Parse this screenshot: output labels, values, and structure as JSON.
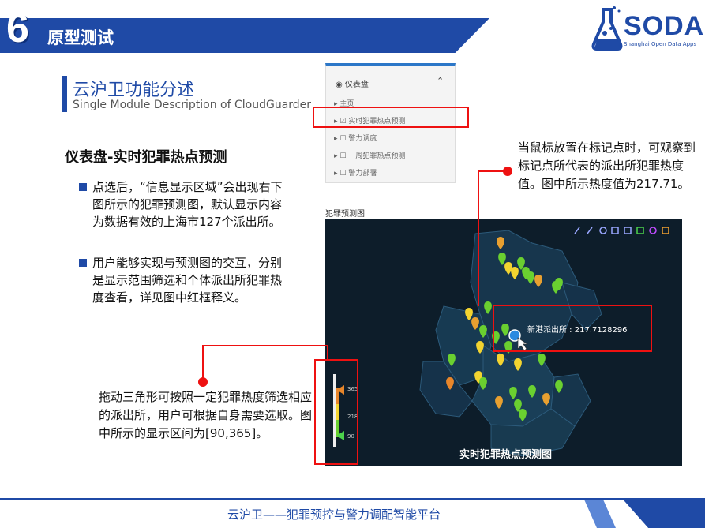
{
  "header": {
    "number": "6",
    "title": "原型测试",
    "logo": {
      "name": "SODA",
      "subtitle": "Shanghai Open Data Apps"
    }
  },
  "section": {
    "title": "云沪卫功能分述",
    "subtitle": "Single Module Description of CloudGuarder"
  },
  "dashboard_title": "仪表盘-实时犯罪热点预测",
  "bullets": [
    "点选后，“信息显示区域”会出现右下图所示的犯罪预测图，默认显示内容为数据有效的上海市127个派出所。",
    "用户能够实现与预测图的交互，分别是显示范围筛选和个体派出所犯罪热度查看，详见图中红框释义。"
  ],
  "menu": {
    "header": "仪表盘",
    "items": [
      "主页",
      "实时犯罪热点预测",
      "警力调度",
      "一周犯罪热点预测",
      "警力部署"
    ]
  },
  "map": {
    "label": "犯罪预测图",
    "caption": "实时犯罪热点预测图",
    "tooltip": "新港派出所 : 217.7128296",
    "slider_values": [
      "365",
      "218",
      "90"
    ]
  },
  "annotations": {
    "right": "当鼠标放置在标记点时，可观察到标记点所代表的派出所犯罪热度值。图中所示热度值为217.71。",
    "left": "拖动三角形可按照一定犯罪热度筛选相应的派出所，用户可根据自身需要选取。图中所示的显示区间为[90,365]。"
  },
  "footer": "云沪卫——犯罪预控与警力调配智能平台",
  "colors": {
    "brand_blue": "#1f4aa6",
    "highlight_red": "#ee1111",
    "map_bg": "#0d1d2a"
  }
}
